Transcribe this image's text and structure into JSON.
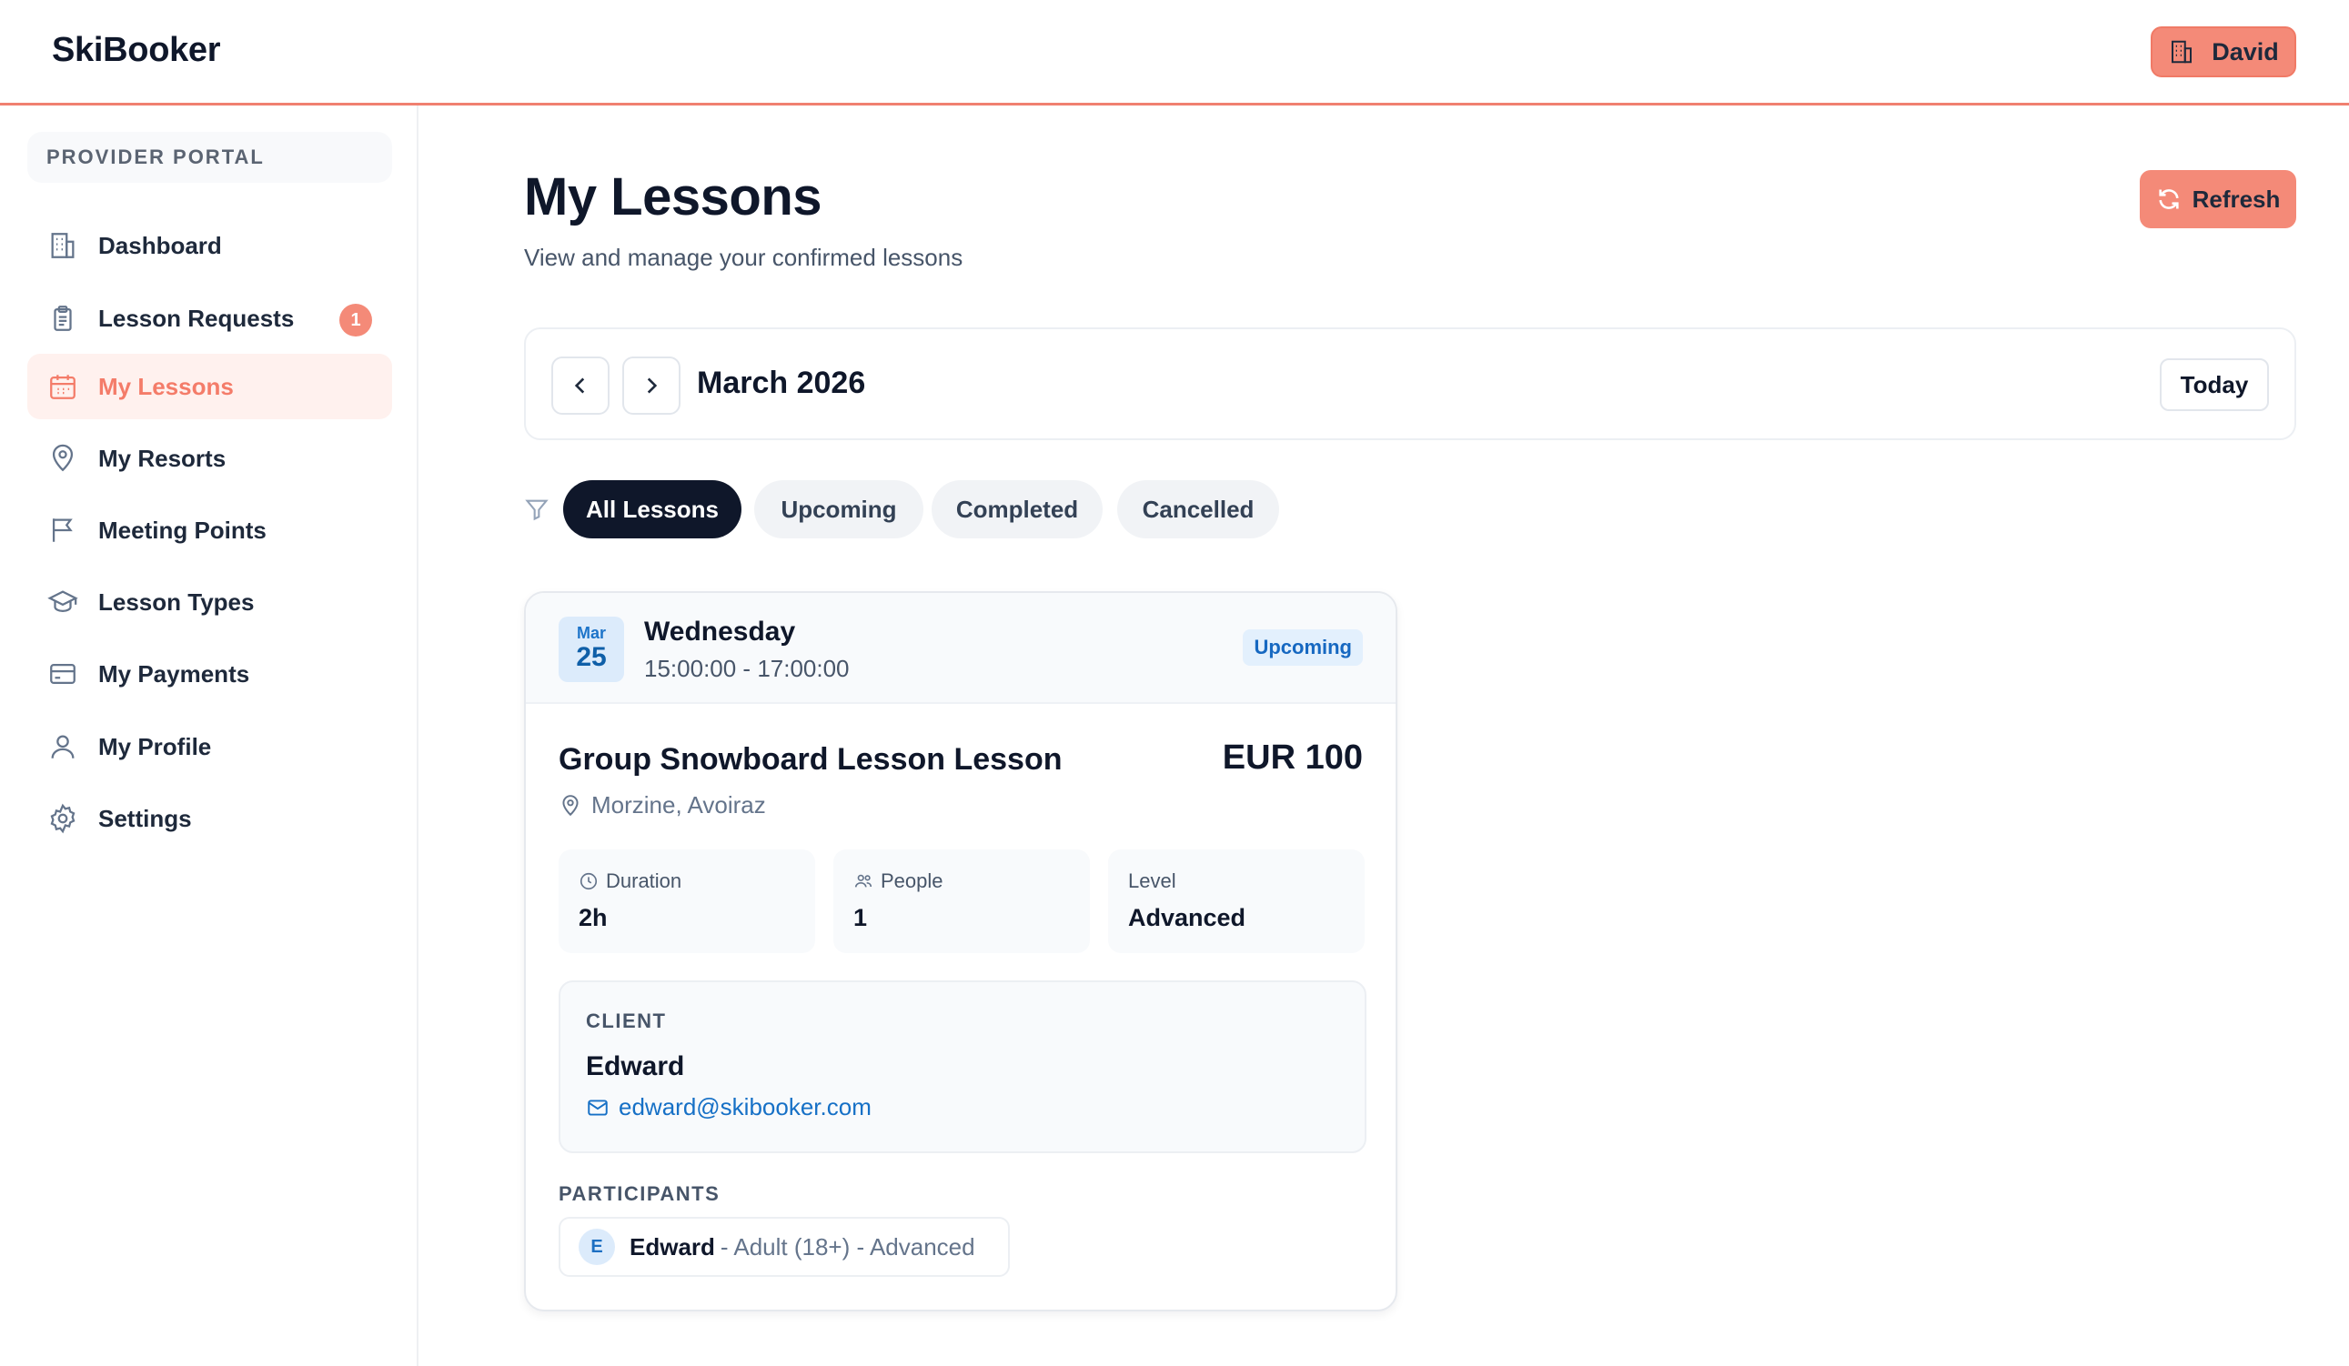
{
  "header": {
    "logo": "SkiBooker",
    "user_name": "David"
  },
  "sidebar": {
    "portal_label": "PROVIDER PORTAL",
    "items": [
      {
        "label": "Dashboard",
        "icon": "building-icon"
      },
      {
        "label": "Lesson Requests",
        "icon": "clipboard-icon",
        "badge": "1"
      },
      {
        "label": "My Lessons",
        "icon": "calendar-icon",
        "active": true
      },
      {
        "label": "My Resorts",
        "icon": "map-pin-icon"
      },
      {
        "label": "Meeting Points",
        "icon": "flag-icon"
      },
      {
        "label": "Lesson Types",
        "icon": "graduation-cap-icon"
      },
      {
        "label": "My Payments",
        "icon": "credit-card-icon"
      },
      {
        "label": "My Profile",
        "icon": "user-icon"
      },
      {
        "label": "Settings",
        "icon": "gear-icon"
      }
    ]
  },
  "main": {
    "title": "My Lessons",
    "subtitle": "View and manage your confirmed lessons",
    "refresh_label": "Refresh",
    "month_label": "March 2026",
    "today_label": "Today",
    "filters": [
      {
        "label": "All Lessons",
        "active": true
      },
      {
        "label": "Upcoming"
      },
      {
        "label": "Completed"
      },
      {
        "label": "Cancelled"
      }
    ]
  },
  "lesson": {
    "date_month": "Mar",
    "date_day": "25",
    "weekday": "Wednesday",
    "time": "15:00:00 - 17:00:00",
    "status": "Upcoming",
    "title": "Group Snowboard Lesson Lesson",
    "price": "EUR 100",
    "location": "Morzine, Avoiraz",
    "stats": {
      "duration_label": "Duration",
      "duration_value": "2h",
      "people_label": "People",
      "people_value": "1",
      "level_label": "Level",
      "level_value": "Advanced"
    },
    "client_label": "CLIENT",
    "client_name": "Edward",
    "client_email": "edward@skibooker.com",
    "participants_label": "PARTICIPANTS",
    "participant": {
      "initial": "E",
      "name": "Edward",
      "detail": "- Adult (18+) - Advanced"
    }
  },
  "colors": {
    "accent": "#f48a78",
    "accent_text": "#f47c69",
    "dark": "#0f172a",
    "link": "#1670c6"
  }
}
